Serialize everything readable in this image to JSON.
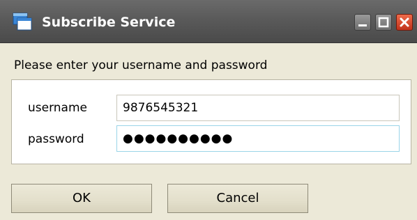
{
  "window": {
    "title": "Subscribe Service",
    "controls": {
      "minimize_icon": "minimize-icon",
      "maximize_icon": "maximize-icon",
      "close_icon": "close-icon"
    },
    "app_icon": "windows-icon"
  },
  "prompt": "Please enter your username and password",
  "form": {
    "username_label": "username",
    "username_value": "9876545321",
    "password_label": "password",
    "password_value": "●●●●●●●●●●"
  },
  "buttons": {
    "ok_label": "OK",
    "cancel_label": "Cancel"
  },
  "colors": {
    "titlebar": "#5a5a5a",
    "dialog_bg": "#ece9d8",
    "close_button": "#d9432a",
    "password_focus_border": "#9ad4e8"
  }
}
